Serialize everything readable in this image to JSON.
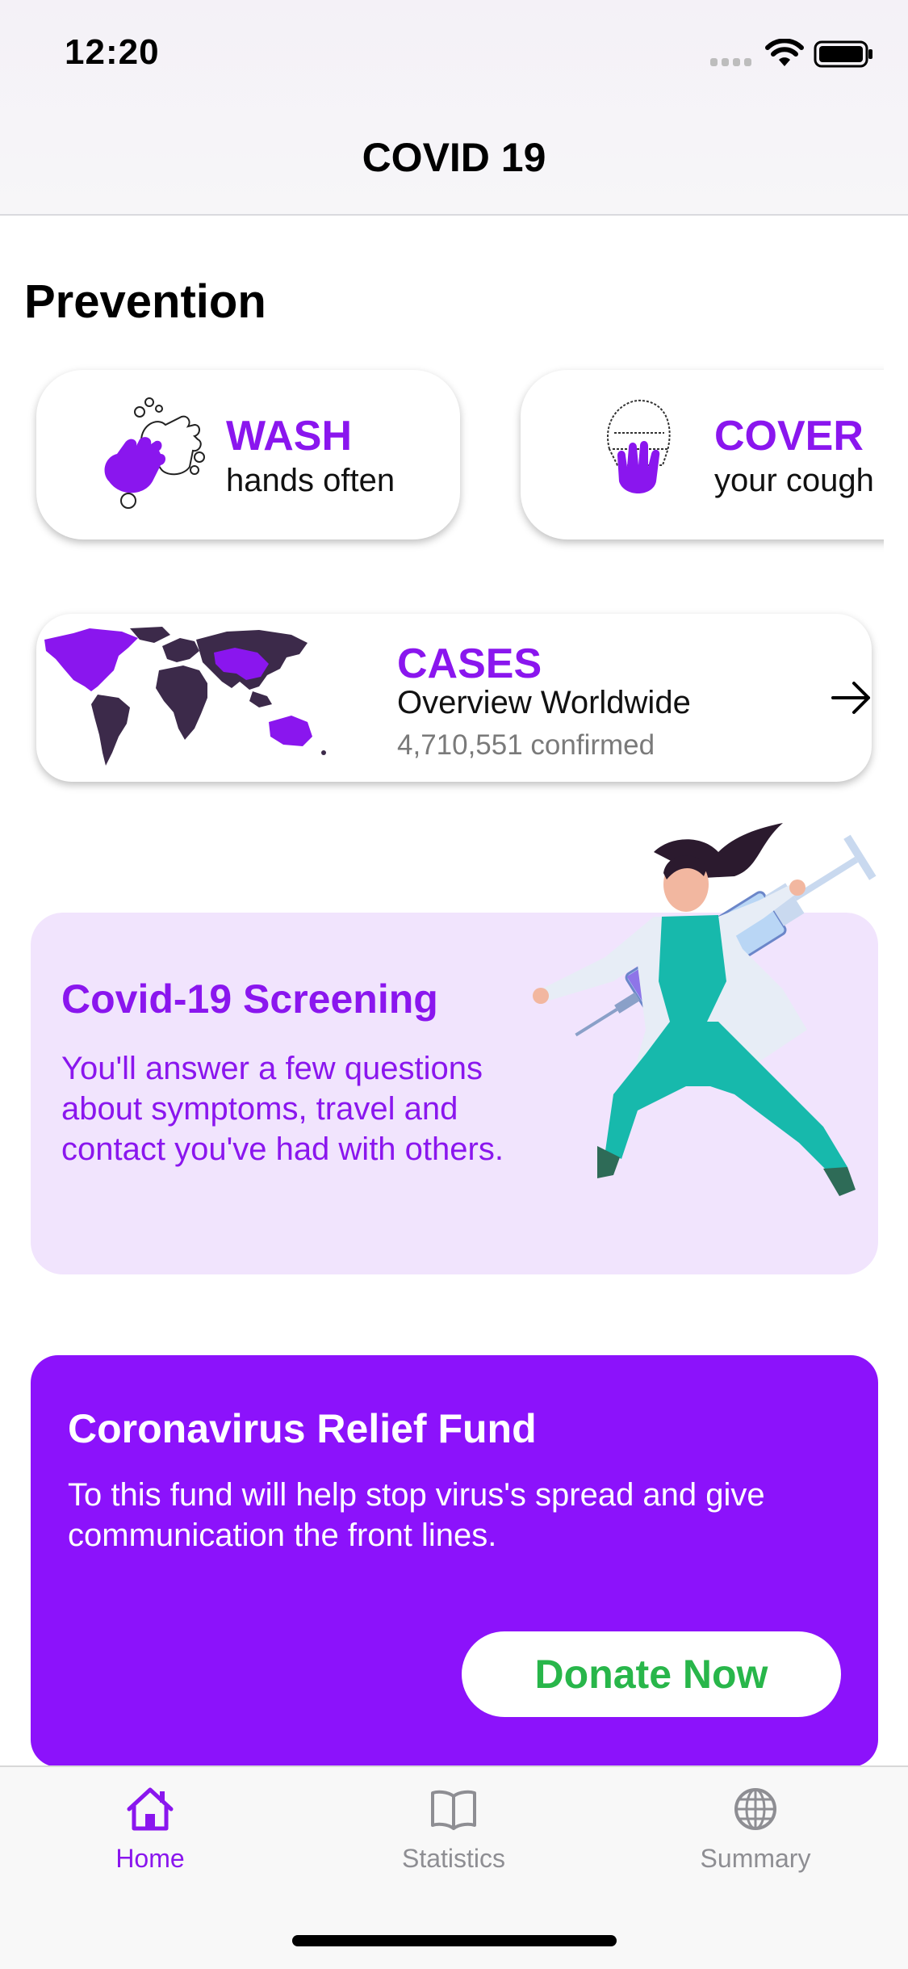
{
  "status_bar": {
    "time": "12:20"
  },
  "nav": {
    "title": "COVID 19"
  },
  "prevention": {
    "title": "Prevention",
    "cards": [
      {
        "title": "WASH",
        "subtitle": "hands often",
        "icon": "hand-wash-icon"
      },
      {
        "title": "COVER",
        "subtitle": "your cough",
        "icon": "cover-cough-icon"
      }
    ]
  },
  "cases": {
    "title": "CASES",
    "subtitle": "Overview Worldwide",
    "count": "4,710,551 confirmed",
    "icon": "world-map-icon"
  },
  "screening": {
    "title": "Covid-19 Screening",
    "text": "You'll answer a few questions about symptoms, travel and contact you've had with others."
  },
  "fund": {
    "title": "Coronavirus Relief Fund",
    "text": "To this fund will help stop virus's spread and give communication the front lines.",
    "button": "Donate Now"
  },
  "tabs": [
    {
      "label": "Home",
      "icon": "home-icon",
      "active": true
    },
    {
      "label": "Statistics",
      "icon": "book-icon",
      "active": false
    },
    {
      "label": "Summary",
      "icon": "globe-icon",
      "active": false
    }
  ],
  "colors": {
    "accent": "#8a16ee",
    "fund_bg": "#8c12fb",
    "screening_bg": "#f1e4fd",
    "donate_text": "#28b64a",
    "inactive_tab": "#8e8e93"
  }
}
